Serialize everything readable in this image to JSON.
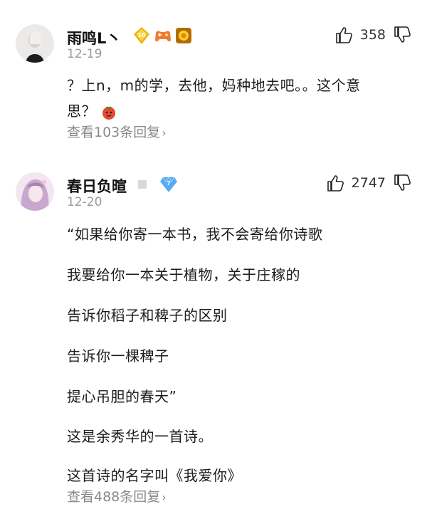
{
  "comments": [
    {
      "username": "雨鸣L丶",
      "level_badge": "10",
      "date": "12-19",
      "likes": "358",
      "text_lines": [
        "？上n，m的学，去他，妈种地去吧。。这个意",
        "思？"
      ],
      "replies_label": "查看103条回复",
      "chevron": "›"
    },
    {
      "username": "春日负暄",
      "level_badge": "7",
      "date": "12-20",
      "likes": "2747",
      "text_lines": [
        "“如果给你寄一本书，我不会寄给你诗歌",
        "我要给你一本关于植物，关于庄稼的",
        "告诉你稻子和稗子的区别",
        "告诉你一棵稗子",
        "提心吊胆的春天”",
        "这是余秀华的一首诗。",
        "这首诗的名字叫《我爱你》"
      ],
      "replies_label": "查看488条回复",
      "chevron": "›"
    }
  ],
  "colors": {
    "muted": "#9a9a9a",
    "badge_gold": "#f0b400",
    "badge_blue": "#5aa9f5"
  }
}
